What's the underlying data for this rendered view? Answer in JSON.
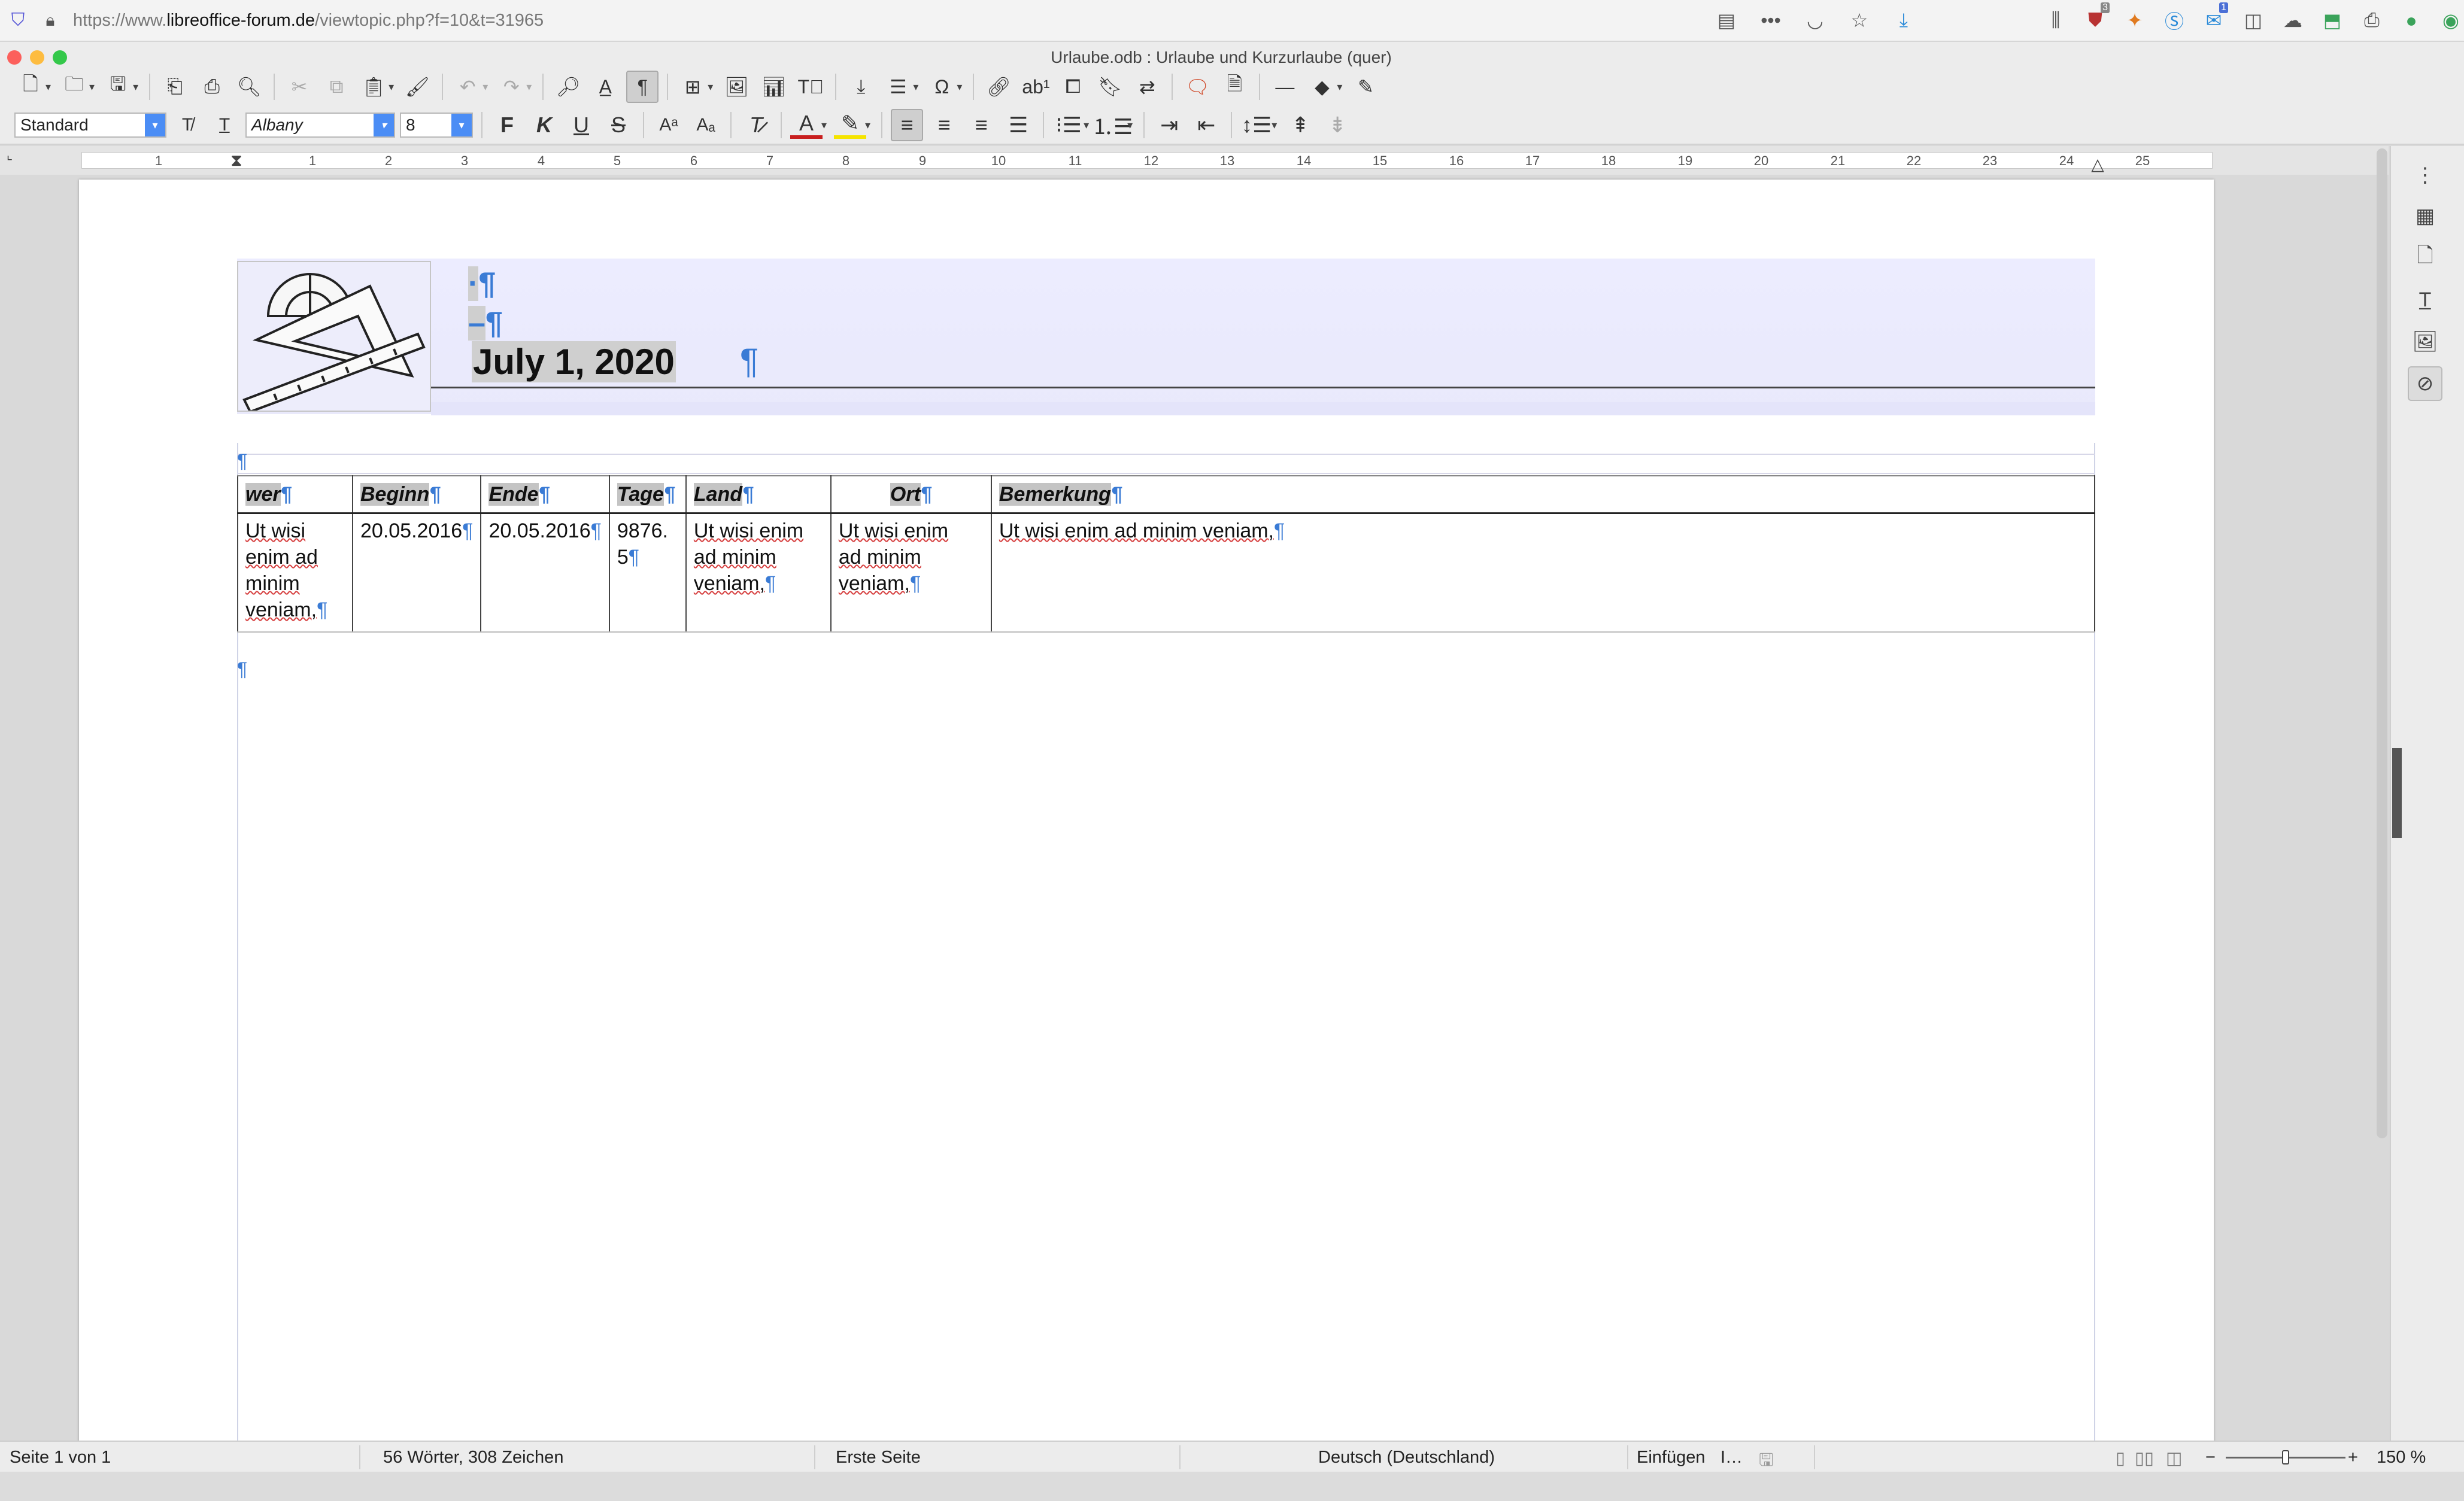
{
  "browser": {
    "url_prefix": "https://www.",
    "url_domain": "libreoffice-forum.de",
    "url_path": "/viewtopic.php?f=10&t=31965",
    "addon_badge_1": "3",
    "addon_badge_2": "1"
  },
  "window": {
    "title": "Urlaube.odb : Urlaube und Kurzurlaube (quer)"
  },
  "formatting": {
    "paragraph_style": "Standard",
    "font_name": "Albany",
    "font_size": "8",
    "bold_glyph": "F",
    "italic_glyph": "K",
    "underline_glyph": "U",
    "strike_glyph": "S"
  },
  "ruler": {
    "numbers": [
      "1",
      "1",
      "2",
      "3",
      "4",
      "5",
      "6",
      "7",
      "8",
      "9",
      "10",
      "11",
      "12",
      "13",
      "14",
      "15",
      "16",
      "17",
      "18",
      "19",
      "20",
      "21",
      "22",
      "23",
      "24",
      "25"
    ]
  },
  "document": {
    "header_date": "July 1, 2020",
    "pilcrow": "¶",
    "table": {
      "headers": [
        "wer",
        "Beginn",
        "Ende",
        "Tage",
        "Land",
        "Ort",
        "Bemerkung"
      ],
      "row": {
        "wer": [
          "Ut wisi",
          "enim ad",
          "minim",
          "veniam,"
        ],
        "beginn": "20.05.2016",
        "ende": "20.05.2016",
        "tage": [
          "9876.",
          "5"
        ],
        "land": [
          "Ut wisi enim",
          "ad minim",
          "veniam,"
        ],
        "ort": [
          "Ut wisi enim",
          "ad minim",
          "veniam,"
        ],
        "bemerkung": "Ut wisi enim ad minim veniam,"
      }
    }
  },
  "statusbar": {
    "page": "Seite 1 von 1",
    "words": "56 Wörter, 308 Zeichen",
    "page_style": "Erste Seite",
    "language": "Deutsch (Deutschland)",
    "insert_mode": "Einfügen",
    "zoom_minus": "−",
    "zoom_plus": "+",
    "zoom": "150 %"
  },
  "colors": {
    "accent_blue": "#4b8df5",
    "pilcrow_blue": "#3a7bd5",
    "font_color_red": "#c81e1e",
    "highlight_yellow": "#f5e400"
  }
}
